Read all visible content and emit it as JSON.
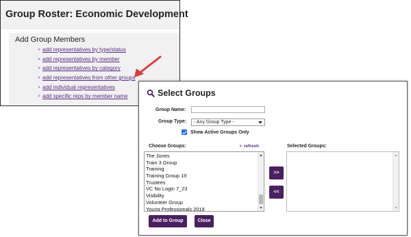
{
  "roster": {
    "title": "Group Roster: Economic Development",
    "card_title": "Add Group Members",
    "links": [
      "add representatives by type/status",
      "add representatives by member",
      "add representatives by category",
      "add representatives from other groups",
      "add individual representatives",
      "add specific reps by member name"
    ]
  },
  "dialog": {
    "title": "Select Groups",
    "group_name_label": "Group Name:",
    "group_name_value": "",
    "group_type_label": "Group Type:",
    "group_type_value": "- Any Group Type -",
    "show_active_label": "Show Active Groups Only",
    "show_active_checked": true,
    "choose_label": "Choose Groups:",
    "refresh_label": "refresh",
    "selected_label": "Selected Groups:",
    "groups": [
      "The Jones",
      "Train 3 Group",
      "Training",
      "Training Group 19",
      "Trustees",
      "VC No Login 7_23",
      "Visibility",
      "Volunteer Group",
      "Young Professionals 2019"
    ],
    "add_label": ">>",
    "remove_label": "<<",
    "add_to_group_label": "Add to Group",
    "close_label": "Close"
  },
  "colors": {
    "accent": "#4a2060",
    "link": "#5b2a86",
    "arrow": "#e03a3a",
    "checkbox": "#1a73e8"
  },
  "icons": {
    "dialog_icon": "search-icon",
    "link_marker": "caret-right-icon"
  }
}
